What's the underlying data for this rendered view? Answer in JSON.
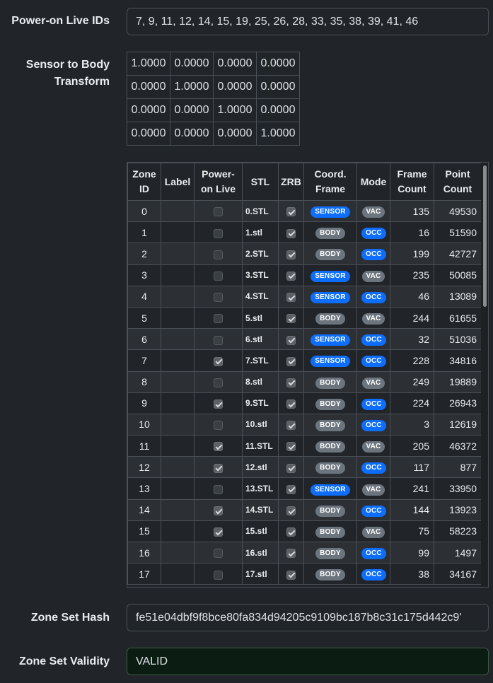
{
  "power_on": {
    "label": "Power-on Live IDs",
    "value": "7, 9, 11, 12, 14, 15, 19, 25, 26, 28, 33, 35, 38, 39, 41, 46"
  },
  "transform": {
    "label_line1": "Sensor to Body",
    "label_line2": "Transform",
    "rows": [
      [
        "1.0000",
        "0.0000",
        "0.0000",
        "0.0000"
      ],
      [
        "0.0000",
        "1.0000",
        "0.0000",
        "0.0000"
      ],
      [
        "0.0000",
        "0.0000",
        "1.0000",
        "0.0000"
      ],
      [
        "0.0000",
        "0.0000",
        "0.0000",
        "1.0000"
      ]
    ]
  },
  "zones": {
    "headers": {
      "zone_id": [
        "Zone",
        "ID"
      ],
      "label": "Label",
      "power_on": [
        "Power-",
        "on Live"
      ],
      "stl": "STL",
      "zrb": "ZRB",
      "frame": [
        "Coord.",
        "Frame"
      ],
      "mode": "Mode",
      "frame_count": [
        "Frame",
        "Count"
      ],
      "point_count": [
        "Point",
        "Count"
      ]
    },
    "rows": [
      {
        "id": "0",
        "label": "",
        "power_on": false,
        "stl": "0.STL",
        "zrb": true,
        "frame": "SENSOR",
        "mode": "VAC",
        "frame_count": "135",
        "point_count": "49530"
      },
      {
        "id": "1",
        "label": "",
        "power_on": false,
        "stl": "1.stl",
        "zrb": true,
        "frame": "BODY",
        "mode": "OCC",
        "frame_count": "16",
        "point_count": "51590"
      },
      {
        "id": "2",
        "label": "",
        "power_on": false,
        "stl": "2.STL",
        "zrb": true,
        "frame": "BODY",
        "mode": "OCC",
        "frame_count": "199",
        "point_count": "42727"
      },
      {
        "id": "3",
        "label": "",
        "power_on": false,
        "stl": "3.STL",
        "zrb": true,
        "frame": "SENSOR",
        "mode": "VAC",
        "frame_count": "235",
        "point_count": "50085"
      },
      {
        "id": "4",
        "label": "",
        "power_on": false,
        "stl": "4.STL",
        "zrb": true,
        "frame": "SENSOR",
        "mode": "OCC",
        "frame_count": "46",
        "point_count": "13089"
      },
      {
        "id": "5",
        "label": "",
        "power_on": false,
        "stl": "5.stl",
        "zrb": true,
        "frame": "BODY",
        "mode": "VAC",
        "frame_count": "244",
        "point_count": "61655"
      },
      {
        "id": "6",
        "label": "",
        "power_on": false,
        "stl": "6.stl",
        "zrb": true,
        "frame": "SENSOR",
        "mode": "OCC",
        "frame_count": "32",
        "point_count": "51036"
      },
      {
        "id": "7",
        "label": "",
        "power_on": true,
        "stl": "7.STL",
        "zrb": true,
        "frame": "SENSOR",
        "mode": "OCC",
        "frame_count": "228",
        "point_count": "34816"
      },
      {
        "id": "8",
        "label": "",
        "power_on": false,
        "stl": "8.stl",
        "zrb": true,
        "frame": "BODY",
        "mode": "VAC",
        "frame_count": "249",
        "point_count": "19889"
      },
      {
        "id": "9",
        "label": "",
        "power_on": true,
        "stl": "9.STL",
        "zrb": true,
        "frame": "BODY",
        "mode": "OCC",
        "frame_count": "224",
        "point_count": "26943"
      },
      {
        "id": "10",
        "label": "",
        "power_on": false,
        "stl": "10.stl",
        "zrb": true,
        "frame": "BODY",
        "mode": "OCC",
        "frame_count": "3",
        "point_count": "12619"
      },
      {
        "id": "11",
        "label": "",
        "power_on": true,
        "stl": "11.STL",
        "zrb": true,
        "frame": "BODY",
        "mode": "VAC",
        "frame_count": "205",
        "point_count": "46372"
      },
      {
        "id": "12",
        "label": "",
        "power_on": true,
        "stl": "12.stl",
        "zrb": true,
        "frame": "BODY",
        "mode": "OCC",
        "frame_count": "117",
        "point_count": "877"
      },
      {
        "id": "13",
        "label": "",
        "power_on": false,
        "stl": "13.STL",
        "zrb": true,
        "frame": "SENSOR",
        "mode": "VAC",
        "frame_count": "241",
        "point_count": "33950"
      },
      {
        "id": "14",
        "label": "",
        "power_on": true,
        "stl": "14.STL",
        "zrb": true,
        "frame": "BODY",
        "mode": "OCC",
        "frame_count": "144",
        "point_count": "13923"
      },
      {
        "id": "15",
        "label": "",
        "power_on": true,
        "stl": "15.stl",
        "zrb": true,
        "frame": "BODY",
        "mode": "VAC",
        "frame_count": "75",
        "point_count": "58223"
      },
      {
        "id": "16",
        "label": "",
        "power_on": false,
        "stl": "16.stl",
        "zrb": true,
        "frame": "BODY",
        "mode": "OCC",
        "frame_count": "99",
        "point_count": "1497"
      },
      {
        "id": "17",
        "label": "",
        "power_on": false,
        "stl": "17.stl",
        "zrb": true,
        "frame": "BODY",
        "mode": "OCC",
        "frame_count": "38",
        "point_count": "34167"
      }
    ]
  },
  "hash": {
    "label": "Zone Set Hash",
    "value": "fe51e04dbf9f8bce80fa834d94205c9109bc187b8c31c175d442c9'"
  },
  "validity": {
    "label": "Zone Set Validity",
    "value": "VALID"
  },
  "colors": {
    "background": "#212529",
    "sensor_badge": "#0d6efd",
    "occ_badge": "#0d6efd",
    "body_badge": "#6c757d",
    "vac_badge": "#6c757d",
    "valid_field_bg": "#0b1c12"
  }
}
